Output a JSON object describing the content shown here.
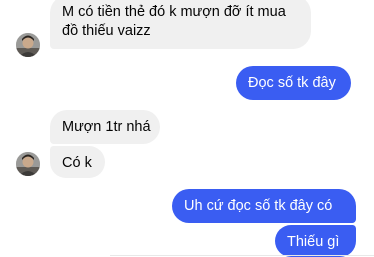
{
  "conversation": {
    "messages": [
      {
        "direction": "incoming",
        "text": "M có tiền thẻ đó k mượn đỡ ít mua đồ thiếu vaizz"
      },
      {
        "direction": "outgoing",
        "text": "Đọc số tk đây"
      },
      {
        "direction": "incoming",
        "text": "Mượn 1tr nhá"
      },
      {
        "direction": "incoming",
        "text": "Có k"
      },
      {
        "direction": "outgoing",
        "text": "Uh cứ đọc số tk đây có"
      },
      {
        "direction": "outgoing",
        "text": "Thiếu gì"
      }
    ],
    "colors": {
      "incoming_bubble": "#f0f0f0",
      "outgoing_bubble": "#3a5df2",
      "incoming_text": "#050505",
      "outgoing_text": "#ffffff"
    },
    "avatar_icon": "contact-avatar-icon"
  }
}
